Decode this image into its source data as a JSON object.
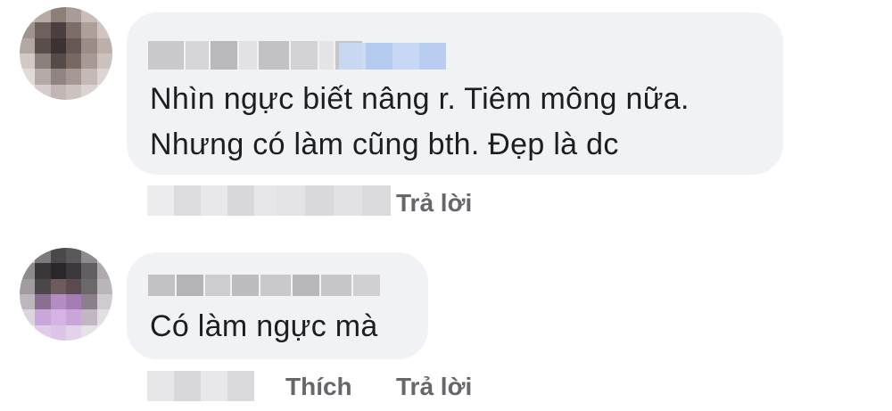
{
  "comments": [
    {
      "text_lines": [
        "Nhìn ngực biết nâng r. Tiêm mông nữa.",
        "Nhưng có làm cũng bth. Đẹp là dc"
      ],
      "reply_label": "Trả lời"
    },
    {
      "text_lines": [
        "Có làm ngực mà"
      ],
      "like_label": "Thích",
      "reply_label": "Trả lời"
    }
  ],
  "colors": {
    "bubble": "#f0f2f5",
    "text": "#1c1e21",
    "action": "#65676b",
    "badge": "#b9cff2"
  }
}
